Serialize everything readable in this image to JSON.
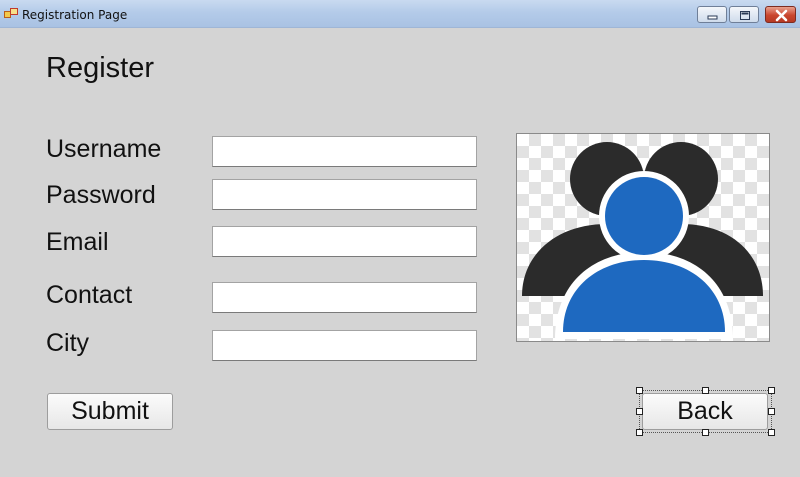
{
  "window": {
    "title": "Registration Page"
  },
  "form": {
    "heading": "Register",
    "fields": [
      {
        "label": "Username",
        "value": ""
      },
      {
        "label": "Password",
        "value": ""
      },
      {
        "label": "Email",
        "value": ""
      },
      {
        "label": "Contact",
        "value": ""
      },
      {
        "label": "City",
        "value": ""
      }
    ],
    "picture_icon": "users-group-icon",
    "submit_label": "Submit",
    "back_label": "Back"
  },
  "colors": {
    "form_background": "#d4d4d4",
    "user_front": "#1e69c0",
    "user_back": "#2b2b2b"
  }
}
